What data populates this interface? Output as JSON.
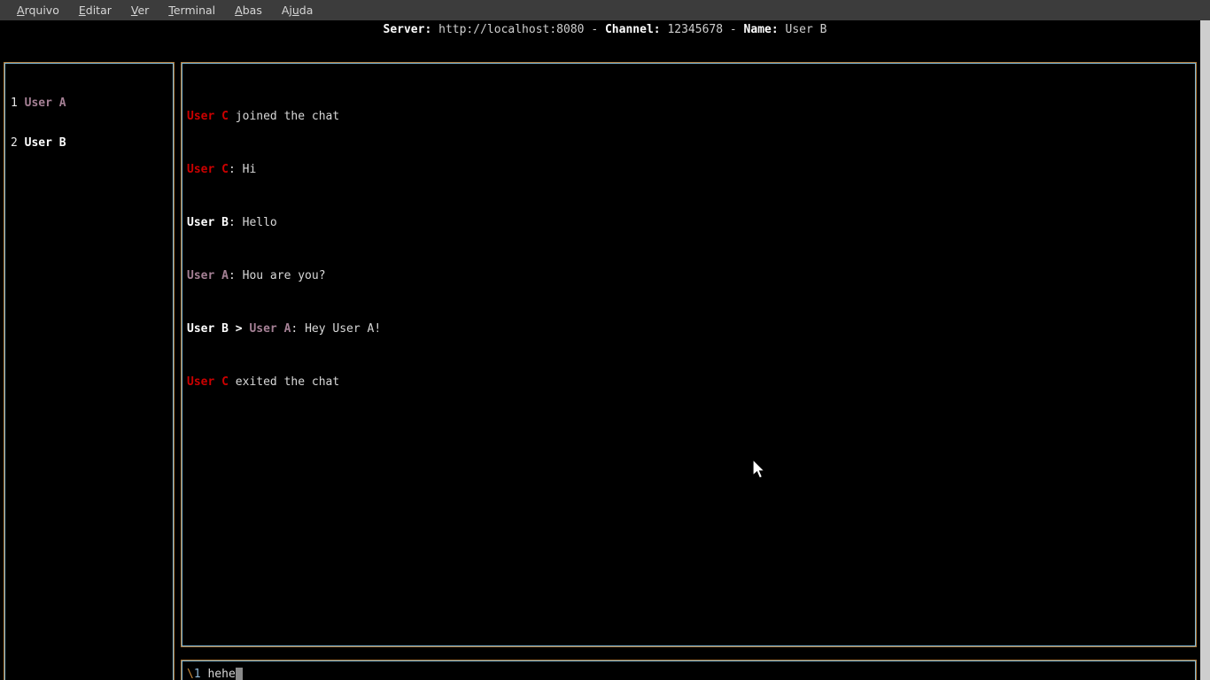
{
  "menubar": {
    "items": [
      {
        "label": "Arquivo",
        "mnemonic": "A"
      },
      {
        "label": "Editar",
        "mnemonic": "E"
      },
      {
        "label": "Ver",
        "mnemonic": "V"
      },
      {
        "label": "Terminal",
        "mnemonic": "T"
      },
      {
        "label": "Abas",
        "mnemonic": "A"
      },
      {
        "label": "Ajuda",
        "mnemonic": "u"
      }
    ]
  },
  "header": {
    "server_label": "Server:",
    "server_value": "http://localhost:8080",
    "sep1": " - ",
    "channel_label": "Channel:",
    "channel_value": "12345678",
    "sep2": " - ",
    "name_label": "Name:",
    "name_value": "User B"
  },
  "users_panel": {
    "users": [
      {
        "index": "1",
        "name": "User A",
        "color": "#a58095"
      },
      {
        "index": "2",
        "name": "User B",
        "color": "#ffffff"
      }
    ]
  },
  "chat_panel": {
    "messages": [
      {
        "kind": "system-join",
        "user": "User C",
        "user_color": "#cc0000",
        "text": " joined the chat"
      },
      {
        "kind": "message",
        "user": "User C",
        "user_color": "#cc0000",
        "text": ": Hi"
      },
      {
        "kind": "message",
        "user": "User B",
        "user_color": "#ffffff",
        "text": ": Hello"
      },
      {
        "kind": "message",
        "user": "User A",
        "user_color": "#a58095",
        "text": ": Hou are you?"
      },
      {
        "kind": "private",
        "user": "User B",
        "user_color": "#ffffff",
        "arrow": " > ",
        "target": "User A",
        "target_color": "#a58095",
        "text": ": Hey User A!"
      },
      {
        "kind": "system-exit",
        "user": "User C",
        "user_color": "#cc0000",
        "text": " exited the chat"
      }
    ]
  },
  "input_panel": {
    "prefix": "\\",
    "prefix_number": "1",
    "value": " hehe",
    "cursor": "block"
  },
  "colors": {
    "menubar_bg": "#3c3c3c",
    "menubar_fg": "#d6d6d6",
    "terminal_bg": "#000000",
    "terminal_fg": "#d8d8d8",
    "border_outer": "#b07a3a",
    "border_inner": "#7fb7d4",
    "accent_red": "#cc0000",
    "accent_purple": "#a58095",
    "accent_white": "#ffffff",
    "cursor": "#8a8a8a",
    "scrollbar": "#cecece"
  }
}
